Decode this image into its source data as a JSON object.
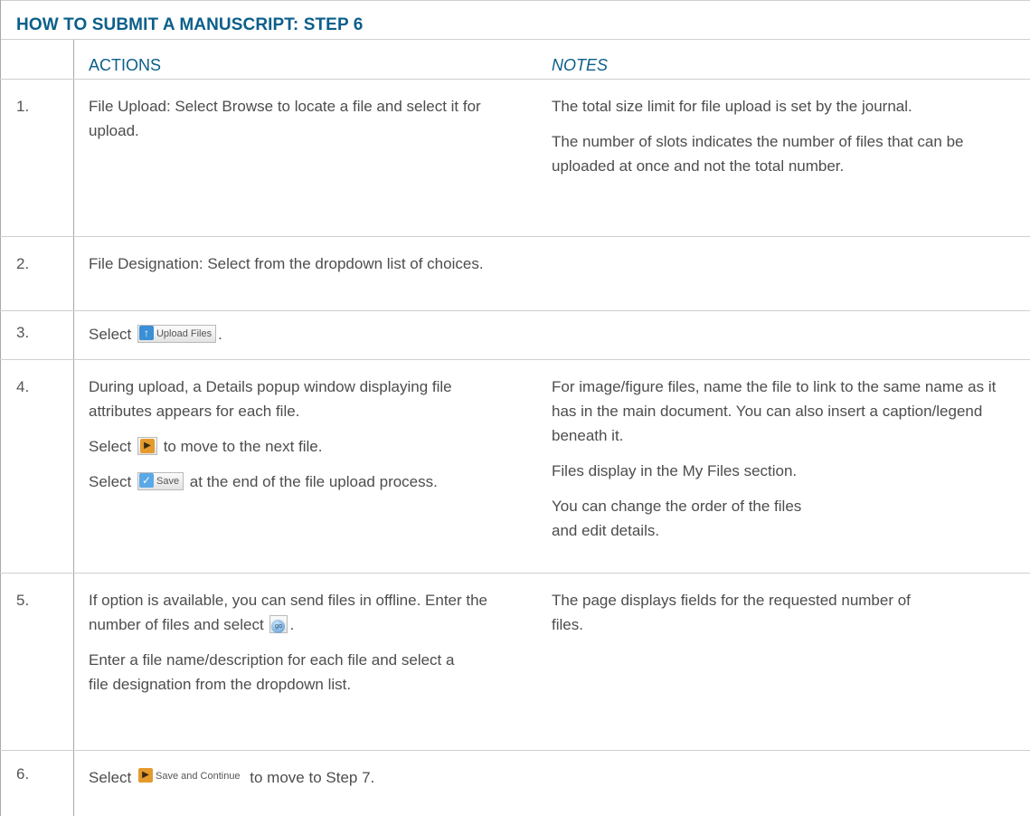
{
  "title": "HOW TO SUBMIT A MANUSCRIPT:  STEP 6",
  "headers": {
    "actions": "ACTIONS",
    "notes": "NOTES"
  },
  "rows": [
    {
      "num": "1.",
      "actions": [
        "File Upload: Select Browse to locate a file and select it for upload."
      ],
      "notes": [
        "The total size limit for file upload is set by the journal.",
        "The number of slots indicates the number of files that can be uploaded at once and not the total number."
      ]
    },
    {
      "num": "2.",
      "actions": [
        "File Designation: Select from the dropdown list of choices."
      ],
      "notes": []
    },
    {
      "num": "3.",
      "actions_pre": "Select ",
      "actions_post": ".",
      "button_label": "Upload Files"
    },
    {
      "num": "4.",
      "actions_p1": "During upload, a Details popup window displaying file attributes appears for each file.",
      "actions_p2_pre": "Select ",
      "actions_p2_post": " to move to the next file.",
      "actions_p3_pre": "Select ",
      "actions_p3_button": "Save",
      "actions_p3_post": " at the end of the file upload process.",
      "notes": [
        "For image/figure files, name the file to link to the same name as it has in the main document. You can also insert a caption/legend beneath it.",
        "Files display in the My Files section.",
        "You can change the order of the files and edit details."
      ]
    },
    {
      "num": "5.",
      "actions_p1_pre": "If option is available, you can send files in offline. Enter the number of files and select ",
      "actions_p1_button": "go",
      "actions_p1_post": ".",
      "actions_p2": "Enter a file name/description for each file and select a file designation from the dropdown list.",
      "notes": [
        "The page displays fields for the requested number of files."
      ]
    },
    {
      "num": "6.",
      "actions_pre": "Select ",
      "button_label": "Save and Continue",
      "actions_post": " to move to Step 7."
    }
  ],
  "icons": {
    "upload": "up-arrow-icon",
    "next": "play-arrow-icon",
    "save": "checkmark-icon",
    "go": "go-icon"
  },
  "colors": {
    "title": "#0b5f8a",
    "text": "#4d4d4d",
    "rule": "#cfcfcf"
  }
}
